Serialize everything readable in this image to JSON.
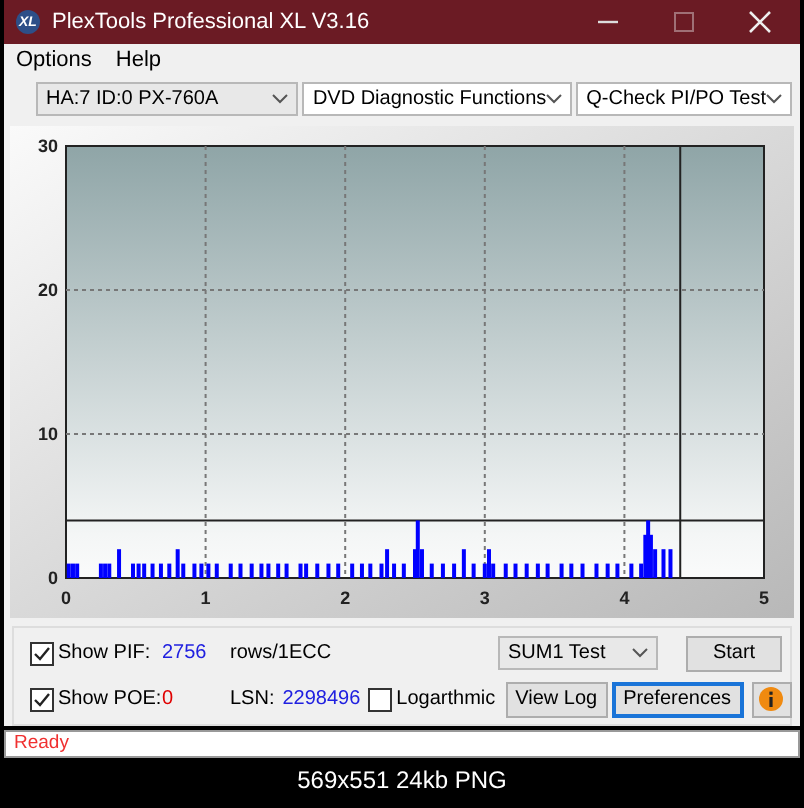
{
  "window": {
    "title": "PlexTools Professional XL V3.16",
    "app_icon": "XL"
  },
  "menu": [
    "Options",
    "Help"
  ],
  "toolbar": {
    "dropdowns": [
      {
        "value": "HA:7 ID:0  PX-760A"
      },
      {
        "value": "DVD Diagnostic Functions"
      },
      {
        "value": "Q-Check PI/PO Test"
      }
    ]
  },
  "chart": {
    "chart_data": {
      "type": "bar",
      "xlim": [
        0,
        5
      ],
      "ylim": [
        0,
        30
      ],
      "xticks": [
        0,
        1,
        2,
        3,
        4,
        5
      ],
      "yticks": [
        0,
        10,
        20,
        30
      ],
      "x": [
        0.02,
        0.05,
        0.08,
        0.25,
        0.28,
        0.31,
        0.38,
        0.48,
        0.52,
        0.56,
        0.62,
        0.68,
        0.74,
        0.8,
        0.84,
        0.92,
        0.97,
        1.02,
        1.08,
        1.18,
        1.25,
        1.33,
        1.4,
        1.45,
        1.52,
        1.58,
        1.68,
        1.72,
        1.8,
        1.88,
        1.95,
        2.05,
        2.12,
        2.18,
        2.26,
        2.3,
        2.35,
        2.42,
        2.5,
        2.52,
        2.55,
        2.62,
        2.7,
        2.78,
        2.85,
        2.92,
        3.0,
        3.03,
        3.06,
        3.15,
        3.22,
        3.3,
        3.38,
        3.45,
        3.55,
        3.62,
        3.7,
        3.8,
        3.88,
        3.95,
        4.05,
        4.12,
        4.15,
        4.17,
        4.19,
        4.22,
        4.28,
        4.33
      ],
      "series": [
        {
          "color": "#0000ff",
          "values": [
            1,
            1,
            1,
            1,
            1,
            1,
            2,
            1,
            1,
            1,
            1,
            1,
            1,
            2,
            1,
            1,
            1,
            1,
            1,
            1,
            1,
            1,
            1,
            1,
            1,
            1,
            1,
            1,
            1,
            1,
            1,
            1,
            1,
            1,
            1,
            2,
            1,
            1,
            2,
            4,
            2,
            1,
            1,
            1,
            2,
            1,
            1,
            2,
            1,
            1,
            1,
            1,
            1,
            1,
            1,
            1,
            1,
            1,
            1,
            1,
            1,
            1,
            3,
            4,
            3,
            2,
            2,
            2
          ]
        }
      ],
      "grid": true,
      "ref_lines": [
        {
          "axis": "y",
          "value": 4
        },
        {
          "axis": "x",
          "value": 4.4
        }
      ]
    }
  },
  "controls": {
    "show_pif": {
      "label": "Show PIF:",
      "checked": true,
      "value": "2756",
      "unit": "rows/1ECC"
    },
    "show_poe": {
      "label": "Show POE:",
      "checked": true,
      "value": "0"
    },
    "lsn": {
      "label": "LSN:",
      "value": "2298496"
    },
    "logarithmic": {
      "label": "Logarthmic",
      "checked": false
    },
    "test_dropdown": {
      "value": "SUM1 Test"
    },
    "buttons": [
      {
        "label": "Start",
        "focused": false
      },
      {
        "label": "View Log",
        "focused": false
      },
      {
        "label": "Preferences",
        "focused": true
      }
    ]
  },
  "status_bar": "Ready",
  "caption": "569x551 24kb PNG"
}
